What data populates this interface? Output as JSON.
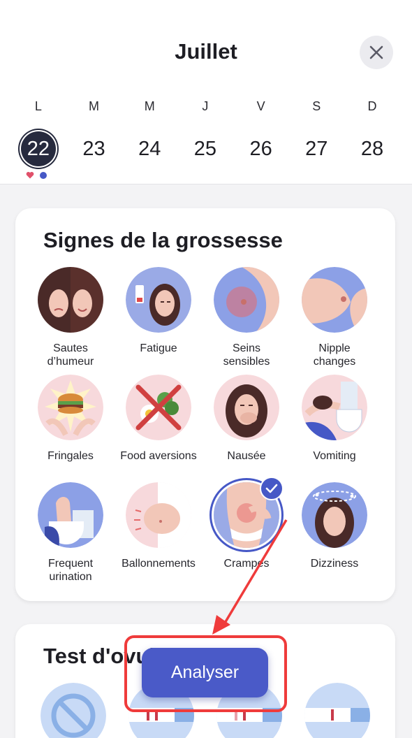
{
  "header": {
    "title": "Juillet",
    "close_icon": "close-icon"
  },
  "calendar": {
    "weekdays": [
      "L",
      "M",
      "M",
      "J",
      "V",
      "S",
      "D"
    ],
    "dates": [
      "22",
      "23",
      "24",
      "25",
      "26",
      "27",
      "28"
    ],
    "selected_date": "22",
    "markers": {
      "heart_color": "#e0506a",
      "dot_color": "#4658c6"
    }
  },
  "signs": {
    "title": "Signes de la grossesse",
    "items": [
      {
        "label": "Sautes\nd’humeur",
        "icon": "mood-swings-icon",
        "checked": false
      },
      {
        "label": "Fatigue",
        "icon": "fatigue-icon",
        "checked": false
      },
      {
        "label": "Seins\nsensibles",
        "icon": "tender-breasts-icon",
        "checked": false
      },
      {
        "label": "Nipple\nchanges",
        "icon": "nipple-changes-icon",
        "checked": false
      },
      {
        "label": "Fringales",
        "icon": "cravings-icon",
        "checked": false
      },
      {
        "label": "Food aversions",
        "icon": "food-aversions-icon",
        "checked": false
      },
      {
        "label": "Nausée",
        "icon": "nausea-icon",
        "checked": false
      },
      {
        "label": "Vomiting",
        "icon": "vomiting-icon",
        "checked": false
      },
      {
        "label": "Frequent\nurination",
        "icon": "frequent-urination-icon",
        "checked": false
      },
      {
        "label": "Ballonnements",
        "icon": "bloating-icon",
        "checked": false
      },
      {
        "label": "Crampes",
        "icon": "cramps-icon",
        "checked": true
      },
      {
        "label": "Dizziness",
        "icon": "dizziness-icon",
        "checked": false
      }
    ]
  },
  "test": {
    "title": "Test d'ovulation"
  },
  "action": {
    "analyse_label": "Analyser"
  },
  "colors": {
    "accent": "#4a5ac8",
    "annotation": "#ef3b3b"
  }
}
